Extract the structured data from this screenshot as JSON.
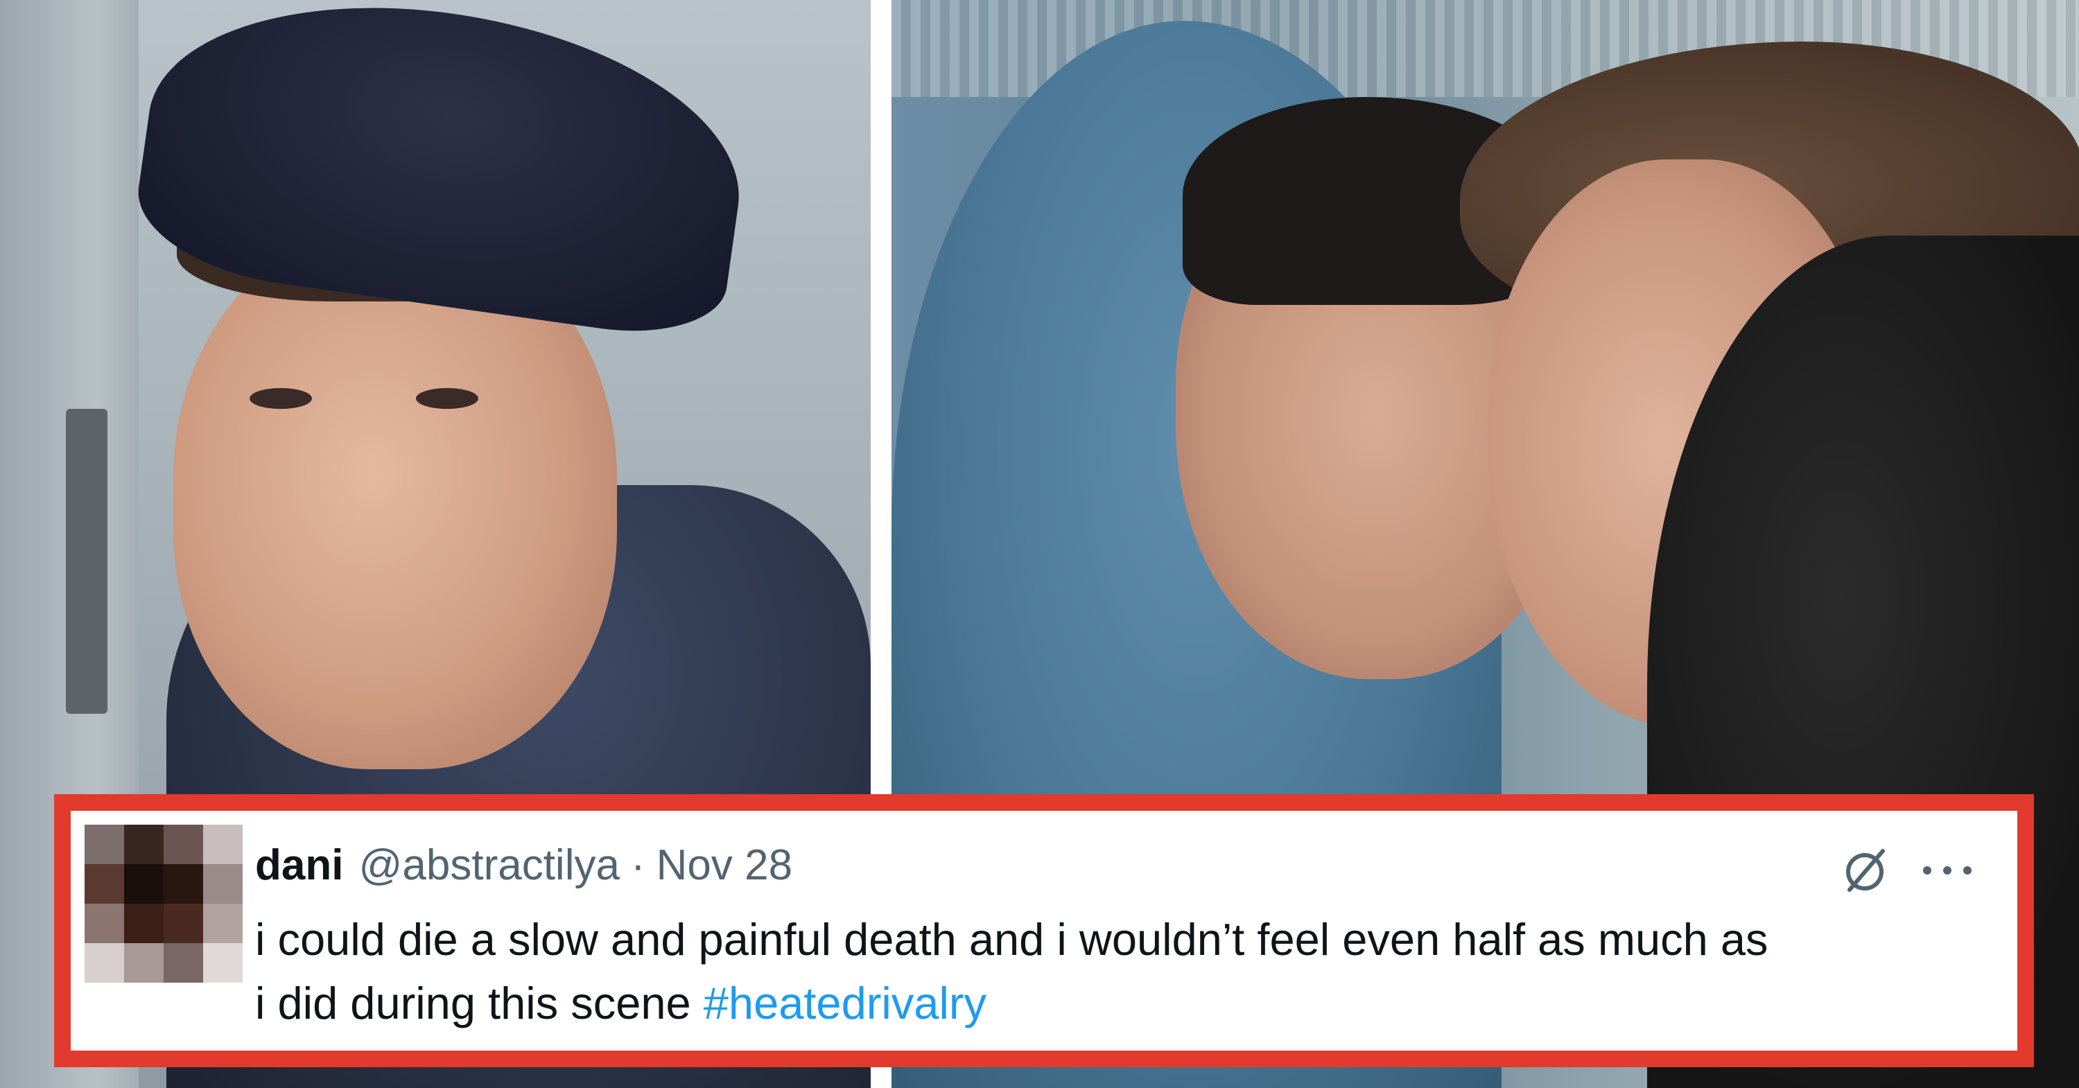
{
  "tweet": {
    "display_name": "dani",
    "handle": "@abstractilya",
    "separator": "·",
    "date": "Nov 28",
    "text": "i could die a slow and painful death and i wouldn’t feel even half as much as\ni did during this scene ",
    "hashtag": "#heatedrivalry",
    "avatar_pixels": [
      "#7b6e6d",
      "#3a2620",
      "#6a5552",
      "#c8bdbc",
      "#5a3a30",
      "#1a0f0c",
      "#2a1610",
      "#9a8a88",
      "#8c7570",
      "#3c1f16",
      "#4a2a20",
      "#b0a3a1",
      "#d8d0cf",
      "#a89896",
      "#7a6664",
      "#e0d9d8"
    ]
  },
  "icons": {
    "grok": "grok-icon",
    "more": "more-options-icon"
  },
  "colors": {
    "frame_border": "#e23a2d",
    "hashtag": "#1d9bf0",
    "secondary_text": "#536471",
    "primary_text": "#0f1419"
  }
}
